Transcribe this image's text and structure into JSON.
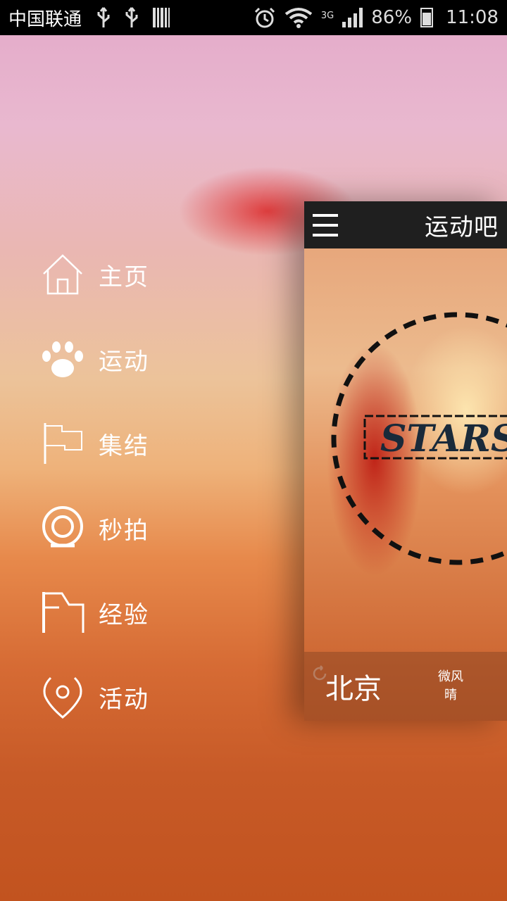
{
  "statusbar": {
    "carrier": "中国联通",
    "network": "3G",
    "battery": "86%",
    "time": "11:08"
  },
  "menu": {
    "items": [
      {
        "label": "主页",
        "icon": "home-icon"
      },
      {
        "label": "运动",
        "icon": "paw-icon"
      },
      {
        "label": "集结",
        "icon": "flag-icon"
      },
      {
        "label": "秒拍",
        "icon": "camera-icon"
      },
      {
        "label": "经验",
        "icon": "experience-icon"
      },
      {
        "label": "活动",
        "icon": "location-pin-icon"
      }
    ]
  },
  "panel": {
    "title": "运动吧",
    "badge_text": "STARS",
    "city": "北京",
    "wind": "微风",
    "condition": "晴"
  }
}
